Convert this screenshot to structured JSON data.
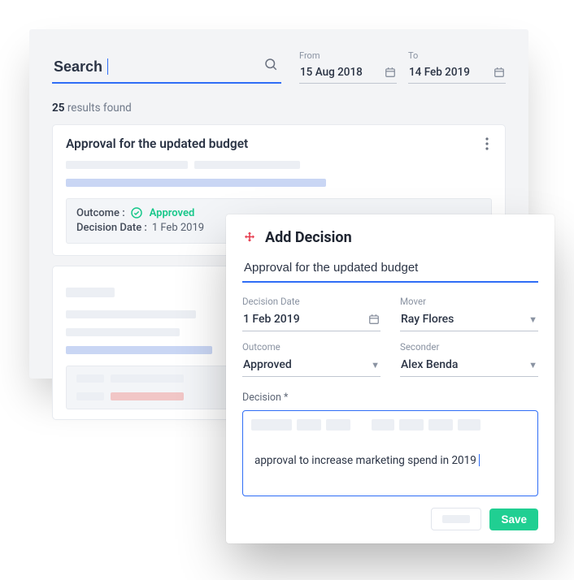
{
  "search": {
    "placeholder": "Search",
    "from_label": "From",
    "from_value": "15 Aug 2018",
    "to_label": "To",
    "to_value": "14 Feb 2019"
  },
  "results": {
    "count": "25",
    "count_suffix": " results found"
  },
  "card1": {
    "title": "Approval for the updated budget",
    "outcome_label": "Outcome :",
    "outcome_value": "Approved",
    "decision_date_label": "Decision Date :",
    "decision_date_value": "1 Feb 2019"
  },
  "modal": {
    "heading": "Add Decision",
    "title_value": "Approval for the updated budget",
    "fields": {
      "decision_date": {
        "label": "Decision Date",
        "value": "1 Feb 2019"
      },
      "mover": {
        "label": "Mover",
        "value": "Ray Flores"
      },
      "outcome": {
        "label": "Outcome",
        "value": "Approved"
      },
      "seconder": {
        "label": "Seconder",
        "value": "Alex Benda"
      }
    },
    "decision_label": "Decision *",
    "decision_text": "approval to increase marketing spend in 2019",
    "save_label": "Save"
  }
}
